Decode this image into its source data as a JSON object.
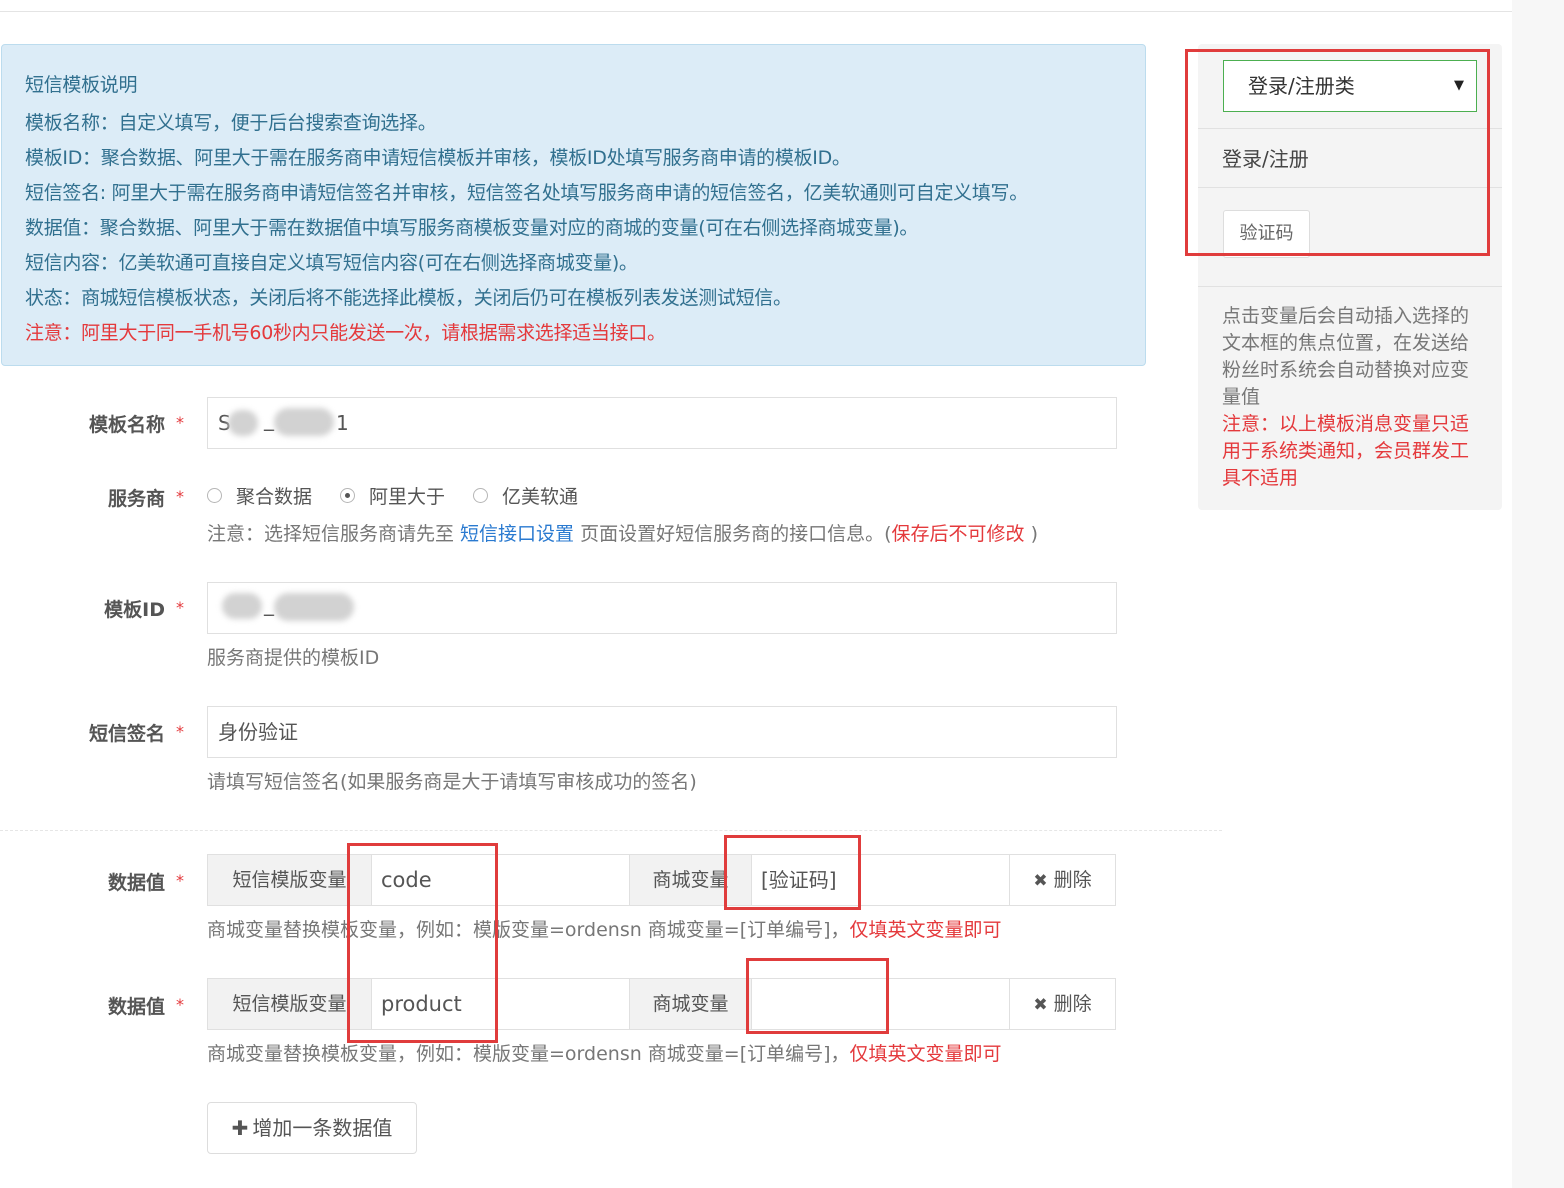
{
  "notice": {
    "title": "短信模板说明",
    "lines": [
      "模板名称：自定义填写，便于后台搜索查询选择。",
      "模板ID：聚合数据、阿里大于需在服务商申请短信模板并审核，模板ID处填写服务商申请的模板ID。",
      "短信签名: 阿里大于需在服务商申请短信签名并审核，短信签名处填写服务商申请的短信签名，亿美软通则可自定义填写。",
      "数据值：聚合数据、阿里大于需在数据值中填写服务商模板变量对应的商城的变量(可在右侧选择商城变量)。",
      "短信内容：亿美软通可直接自定义填写短信内容(可在右侧选择商城变量)。",
      "状态：商城短信模板状态，关闭后将不能选择此模板，关闭后仍可在模板列表发送测试短信。"
    ],
    "warning": "注意：阿里大于同一手机号60秒内只能发送一次，请根据需求选择适当接口。"
  },
  "form": {
    "required_mark": "*",
    "template_name": {
      "label": "模板名称",
      "value_start": "S",
      "value_mid": "_",
      "value_end": "1"
    },
    "provider": {
      "label": "服务商",
      "options": [
        "聚合数据",
        "阿里大于",
        "亿美软通"
      ],
      "selected": "阿里大于",
      "note_prefix": "注意：选择短信服务商请先至 ",
      "note_link": "短信接口设置",
      "note_middle": " 页面设置好短信服务商的接口信息。(",
      "note_red": "保存后不可修改",
      "note_suffix": " )"
    },
    "template_id": {
      "label": "模板ID",
      "value_visible": "_",
      "help": "服务商提供的模板ID"
    },
    "signature": {
      "label": "短信签名",
      "value": "身份验证",
      "help": "请填写短信签名(如果服务商是大于请填写审核成功的签名)"
    },
    "data_values": {
      "label": "数据值",
      "sms_var_label": "短信模版变量",
      "mall_var_label": "商城变量",
      "delete_label": "删除",
      "delete_icon": "✖",
      "help_prefix": "商城变量替换模板变量，例如：模版变量=ordensn 商城变量=[订单编号]，",
      "help_red": "仅填英文变量即可",
      "rows": [
        {
          "sms_var": "code",
          "mall_var": "[验证码]"
        },
        {
          "sms_var": "product",
          "mall_var": ""
        }
      ]
    },
    "add_button": {
      "icon": "✚",
      "label": "增加一条数据值"
    }
  },
  "side": {
    "select_value": "登录/注册类",
    "select_caret": "▼",
    "category_title": "登录/注册",
    "variables": [
      "验证码"
    ],
    "note": "点击变量后会自动插入选择的文本框的焦点位置，在发送给粉丝时系统会自动替换对应变量值",
    "warning": "注意：以上模板消息变量只适用于系统类通知，会员群发工具不适用"
  },
  "colors": {
    "highlight": "#e03c3c",
    "info_bg": "#dcecf7",
    "warn": "#e4393c",
    "link": "#2a7ad0"
  }
}
